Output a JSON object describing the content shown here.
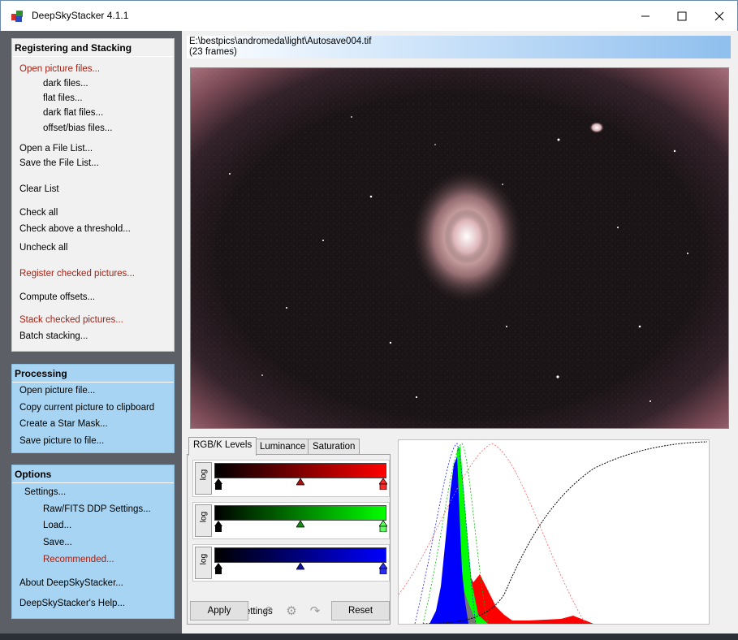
{
  "window": {
    "title": "DeepSkyStacker 4.1.1"
  },
  "sidebar": {
    "registering": {
      "title": "Registering and Stacking",
      "items": [
        {
          "label": "Open picture files...",
          "red": true
        },
        {
          "label": "dark files..."
        },
        {
          "label": "flat files..."
        },
        {
          "label": "dark flat files..."
        },
        {
          "label": "offset/bias files..."
        },
        {
          "label": "Open a File List..."
        },
        {
          "label": "Save the File List..."
        },
        {
          "label": "Clear List"
        },
        {
          "label": "Check all"
        },
        {
          "label": "Check above a threshold..."
        },
        {
          "label": "Uncheck all"
        },
        {
          "label": "Register checked pictures...",
          "red": true
        },
        {
          "label": "Compute offsets..."
        },
        {
          "label": "Stack checked pictures...",
          "red": true
        },
        {
          "label": "Batch stacking..."
        }
      ]
    },
    "processing": {
      "title": "Processing",
      "items": [
        {
          "label": "Open picture file..."
        },
        {
          "label": "Copy current picture to clipboard"
        },
        {
          "label": "Create a Star Mask..."
        },
        {
          "label": "Save picture to file..."
        }
      ]
    },
    "options": {
      "title": "Options",
      "items": [
        {
          "label": "Settings..."
        },
        {
          "label": "Raw/FITS DDP Settings..."
        },
        {
          "label": "Load..."
        },
        {
          "label": "Save..."
        },
        {
          "label": "Recommended...",
          "red": true
        },
        {
          "label": "About DeepSkyStacker..."
        },
        {
          "label": "DeepSkyStacker's Help..."
        }
      ]
    }
  },
  "path": {
    "file": "E:\\bestpics\\andromeda\\light\\Autosave004.tif",
    "frames": "(23 frames)"
  },
  "tabs": [
    {
      "label": "RGB/K Levels",
      "active": true
    },
    {
      "label": "Luminance"
    },
    {
      "label": "Saturation"
    }
  ],
  "levels": {
    "log_label": "log",
    "red_color": "#ff0000",
    "green_color": "#00ff00",
    "blue_color": "#0000ff"
  },
  "linked_settings": {
    "label": "Linked settings",
    "checked": false
  },
  "buttons": {
    "apply": "Apply",
    "reset": "Reset"
  },
  "icons": [
    "undo-icon",
    "settings-gear-icon",
    "redo-icon"
  ]
}
